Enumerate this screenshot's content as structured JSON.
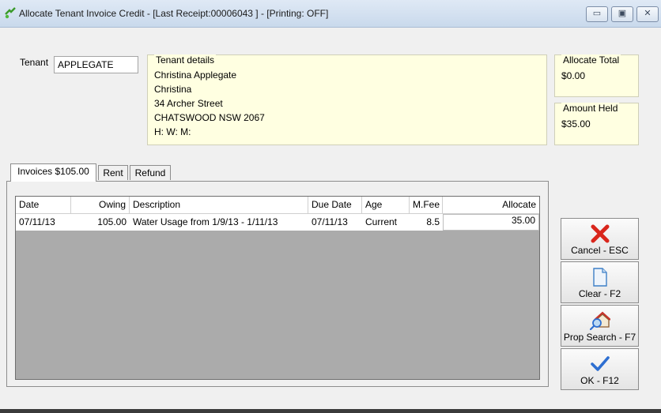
{
  "window": {
    "title": "Allocate Tenant Invoice Credit - [Last Receipt:00006043 ] - [Printing: OFF]",
    "buttons": {
      "minimize": "▭",
      "maximize": "▣",
      "close": "✕"
    }
  },
  "tenant": {
    "label": "Tenant",
    "value": "APPLEGATE"
  },
  "tenant_details": {
    "title": "Tenant details",
    "lines": [
      "Christina Applegate",
      "Christina",
      "34 Archer Street",
      "CHATSWOOD  NSW  2067",
      "H:   W:   M:"
    ]
  },
  "allocate_total": {
    "title": "Allocate Total",
    "value": "$0.00"
  },
  "amount_held": {
    "title": "Amount Held",
    "value": "$35.00"
  },
  "tabs": [
    {
      "label": "Invoices  $105.00",
      "active": true
    },
    {
      "label": "Rent",
      "active": false
    },
    {
      "label": "Refund",
      "active": false
    }
  ],
  "table": {
    "headers": [
      "Date",
      "Owing",
      "Description",
      "Due Date",
      "Age",
      "M.Fee",
      "Allocate"
    ],
    "rows": [
      [
        "07/11/13",
        "105.00",
        "Water Usage from 1/9/13 - 1/11/13",
        "07/11/13",
        "Current",
        "8.5",
        "35.00"
      ]
    ]
  },
  "side_buttons": [
    {
      "label": "Cancel - ESC",
      "icon": "cancel-x-icon"
    },
    {
      "label": "Clear - F2",
      "icon": "blank-document-icon"
    },
    {
      "label": "Prop Search - F7",
      "icon": "house-search-icon"
    },
    {
      "label": "OK - F12",
      "icon": "checkmark-icon"
    }
  ],
  "colors": {
    "info_panel": "#ffffe1",
    "grid_empty": "#ababab",
    "cancel_red": "#d9261c",
    "ok_blue": "#2e6fd1"
  }
}
